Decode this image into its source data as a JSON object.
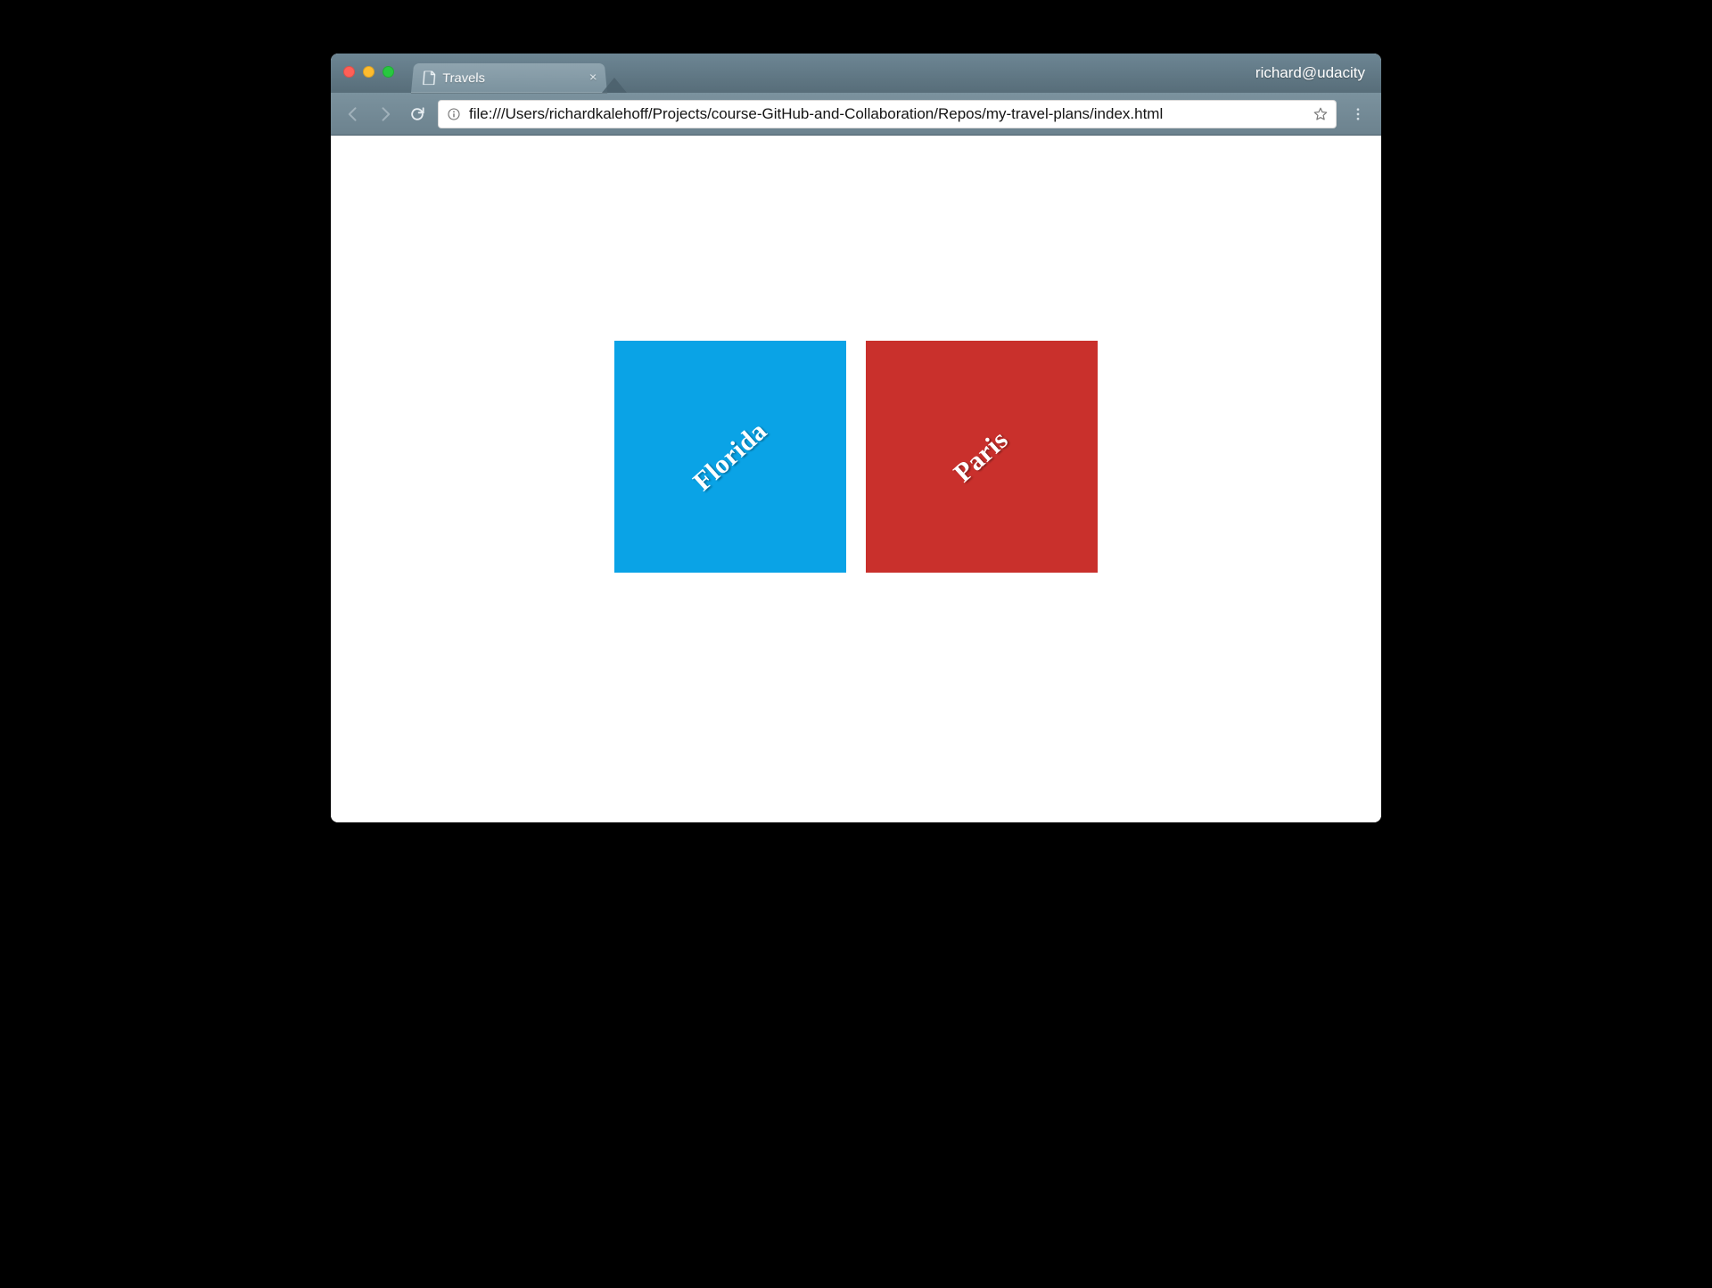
{
  "browser": {
    "tab_title": "Travels",
    "profile": "richard@udacity",
    "url": "file:///Users/richardkalehoff/Projects/course-GitHub-and-Collaboration/Repos/my-travel-plans/index.html"
  },
  "content": {
    "cards": [
      {
        "label": "Florida",
        "color": "#0aa3e6"
      },
      {
        "label": "Paris",
        "color": "#c9302c"
      }
    ]
  }
}
